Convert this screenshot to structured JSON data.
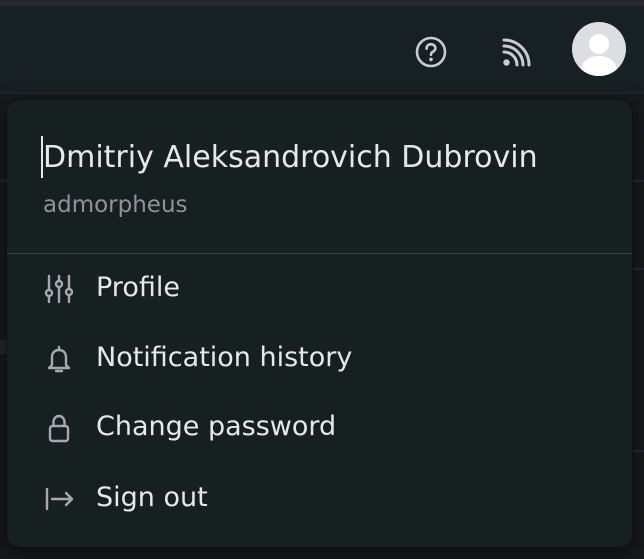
{
  "header": {
    "icons": [
      "help-icon",
      "rss-icon",
      "avatar-icon"
    ],
    "colors": {
      "header_bg": "#172022",
      "icon": "#c9cdd1",
      "avatar_bg": "#dcdfe2"
    }
  },
  "user_menu": {
    "user_name": "Dmitriy Aleksandrovich Dubrovin",
    "username": "admorpheus",
    "items": [
      {
        "label": "Profile",
        "icon": "sliders-icon"
      },
      {
        "label": "Notification history",
        "icon": "bell-icon"
      },
      {
        "label": "Change password",
        "icon": "lock-icon"
      },
      {
        "label": "Sign out",
        "icon": "sign-out-icon"
      }
    ],
    "colors": {
      "menu_bg": "#162021",
      "text": "#e6e8ea",
      "muted": "#8d9499",
      "divider": "#384043"
    }
  }
}
